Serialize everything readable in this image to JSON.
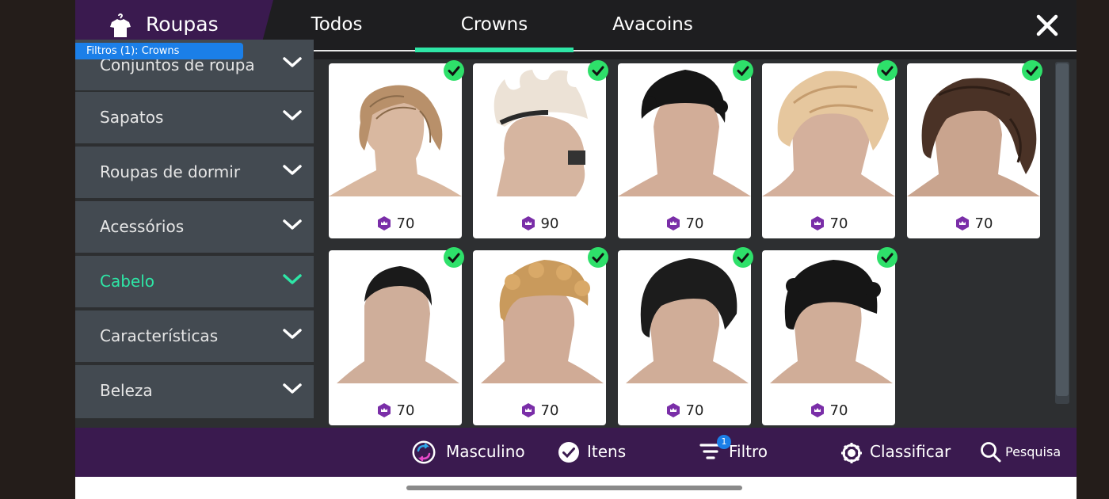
{
  "header": {
    "title": "Roupas",
    "filter_pill": "Filtros (1): Crowns",
    "tabs": [
      {
        "label": "Todos",
        "active": false
      },
      {
        "label": "Crowns",
        "active": true
      },
      {
        "label": "Avacoins",
        "active": false
      }
    ]
  },
  "sidebar": {
    "items": [
      {
        "label": "Conjuntos de roupa",
        "active": false
      },
      {
        "label": "Sapatos",
        "active": false
      },
      {
        "label": "Roupas de dormir",
        "active": false
      },
      {
        "label": "Acessórios",
        "active": false
      },
      {
        "label": "Cabelo",
        "active": true
      },
      {
        "label": "Características",
        "active": false
      },
      {
        "label": "Beleza",
        "active": false
      }
    ]
  },
  "grid": {
    "items": [
      {
        "price": "70",
        "hair": "light-brown-wavy",
        "checked": true
      },
      {
        "price": "90",
        "hair": "blonde-spiky",
        "checked": true
      },
      {
        "price": "70",
        "hair": "black-curly-short",
        "checked": true
      },
      {
        "price": "70",
        "hair": "blonde-shaggy",
        "checked": true
      },
      {
        "price": "70",
        "hair": "dark-brown-long-wavy",
        "checked": true
      },
      {
        "price": "70",
        "hair": "black-buzz",
        "checked": true
      },
      {
        "price": "70",
        "hair": "golden-curly",
        "checked": true
      },
      {
        "price": "70",
        "hair": "black-wavy-fringe",
        "checked": true
      },
      {
        "price": "70",
        "hair": "black-messy-curly",
        "checked": true
      }
    ]
  },
  "bottombar": {
    "gender": "Masculino",
    "items": "Itens",
    "filter": "Filtro",
    "filter_badge": "1",
    "sort": "Classificar",
    "search": "Pesquisa"
  },
  "colors": {
    "accent": "#2ee6a6",
    "brand_purple": "#3a1a4f",
    "filter_blue": "#1b7fe8",
    "check_green": "#2ee06a",
    "crown_purple": "#7a2ea8"
  }
}
